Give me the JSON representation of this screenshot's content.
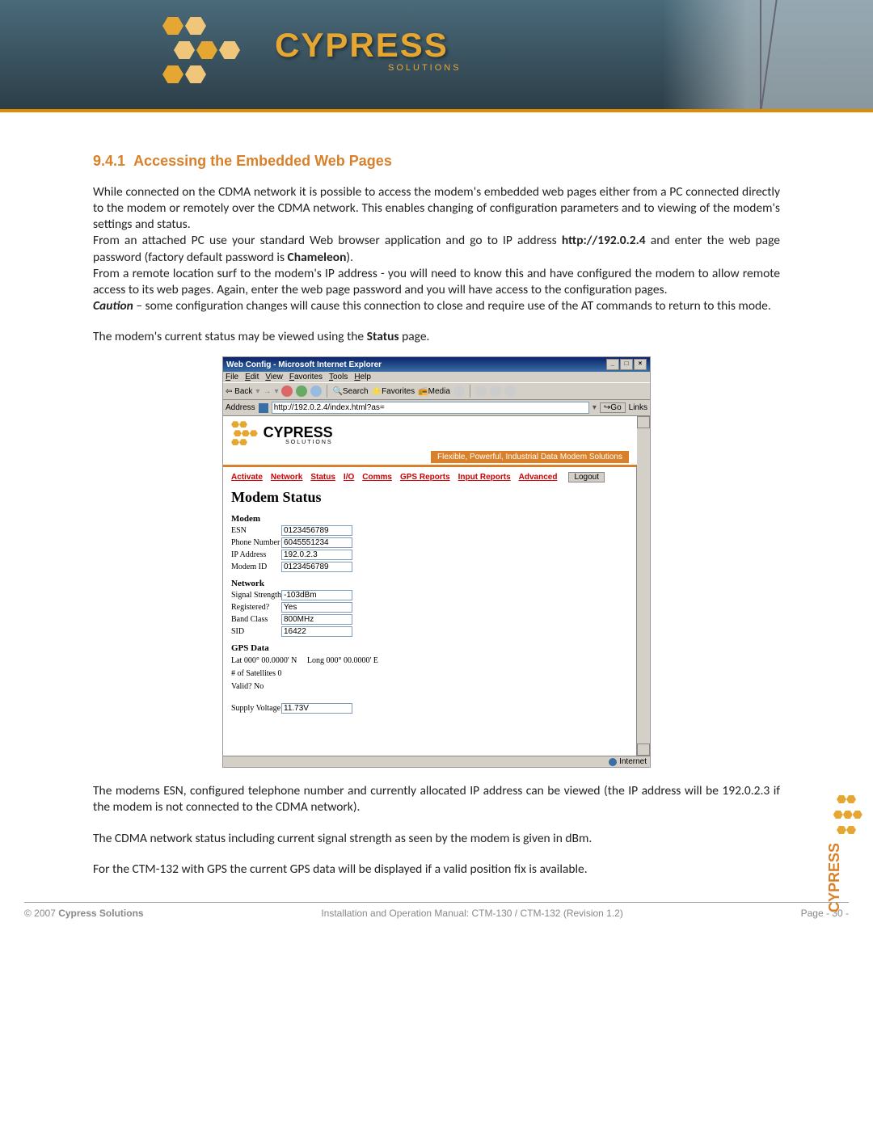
{
  "page": {
    "section_number": "9.4.1",
    "section_title": "Accessing the Embedded Web Pages",
    "para1": "While connected on the CDMA network it is possible to access the modem's embedded web pages either from a PC connected directly to the modem or remotely over the CDMA network. This enables changing of configuration parameters and to viewing of the modem's settings and status.",
    "para2a": "From an attached PC use your standard Web browser application and go to IP address ",
    "para2_url": "http://192.0.2.4",
    "para2b": " and enter the web page password (factory default password is ",
    "para2_pw": "Chameleon",
    "para2c": ").",
    "para3": "From a remote location surf to the modem's IP address - you will need to know this and have configured the modem to allow remote access to its web pages. Again, enter the web page password and you will have access to the configuration pages.",
    "caution_label": "Caution",
    "caution_text": " – some configuration changes will cause this connection to close and require use of the AT commands to return to this mode.",
    "para5a": "The modem's current status may be viewed using the ",
    "para5_bold": "Status",
    "para5b": " page.",
    "para6": "The modems ESN, configured telephone number and currently allocated IP address can be viewed (the IP address will be 192.0.2.3 if the modem is not connected to the CDMA network).",
    "para7": "The CDMA network status including current signal strength as seen by the modem is given in dBm.",
    "para8": "For the CTM-132 with GPS the current GPS data will be displayed if a valid position fix is available."
  },
  "browser": {
    "title": "Web Config - Microsoft Internet Explorer",
    "menus": [
      "File",
      "Edit",
      "View",
      "Favorites",
      "Tools",
      "Help"
    ],
    "back": "Back",
    "toolbar_search": "Search",
    "toolbar_favorites": "Favorites",
    "toolbar_media": "Media",
    "address_label": "Address",
    "address_url": "http://192.0.2.4/index.html?as=",
    "go": "Go",
    "links": "Links",
    "status_done": "",
    "status_zone": "Internet"
  },
  "webpage": {
    "brand": "CYPRESS",
    "brand_sub": "SOLUTIONS",
    "tagline": "Flexible, Powerful, Industrial Data Modem Solutions",
    "nav": [
      "Activate",
      "Network",
      "Status",
      "I/O",
      "Comms",
      "GPS Reports",
      "Input Reports",
      "Advanced"
    ],
    "logout": "Logout",
    "heading": "Modem Status",
    "sect_modem": "Modem",
    "rows_modem": [
      {
        "label": "ESN",
        "value": "0123456789"
      },
      {
        "label": "Phone Number",
        "value": "6045551234"
      },
      {
        "label": "IP Address",
        "value": "192.0.2.3"
      },
      {
        "label": "Modem ID",
        "value": "0123456789"
      }
    ],
    "sect_network": "Network",
    "rows_network": [
      {
        "label": "Signal Strength",
        "value": "-103dBm"
      },
      {
        "label": "Registered?",
        "value": "Yes"
      },
      {
        "label": "Band Class",
        "value": "800MHz"
      },
      {
        "label": "SID",
        "value": "16422"
      }
    ],
    "sect_gps": "GPS Data",
    "gps_lat": "Lat 000° 00.0000' N",
    "gps_long": "Long 000° 00.0000' E",
    "gps_sats": "# of Satellites 0",
    "gps_valid": "Valid? No",
    "supply_label": "Supply Voltage",
    "supply_value": "11.73V"
  },
  "footer": {
    "copyright_pre": "© 2007 ",
    "copyright_bold": "Cypress Solutions",
    "center": "Installation and Operation Manual: CTM-130 / CTM-132 (Revision 1.2)",
    "right": "Page - 30 -"
  },
  "brand": {
    "name": "CYPRESS",
    "sub": "SOLUTIONS"
  }
}
